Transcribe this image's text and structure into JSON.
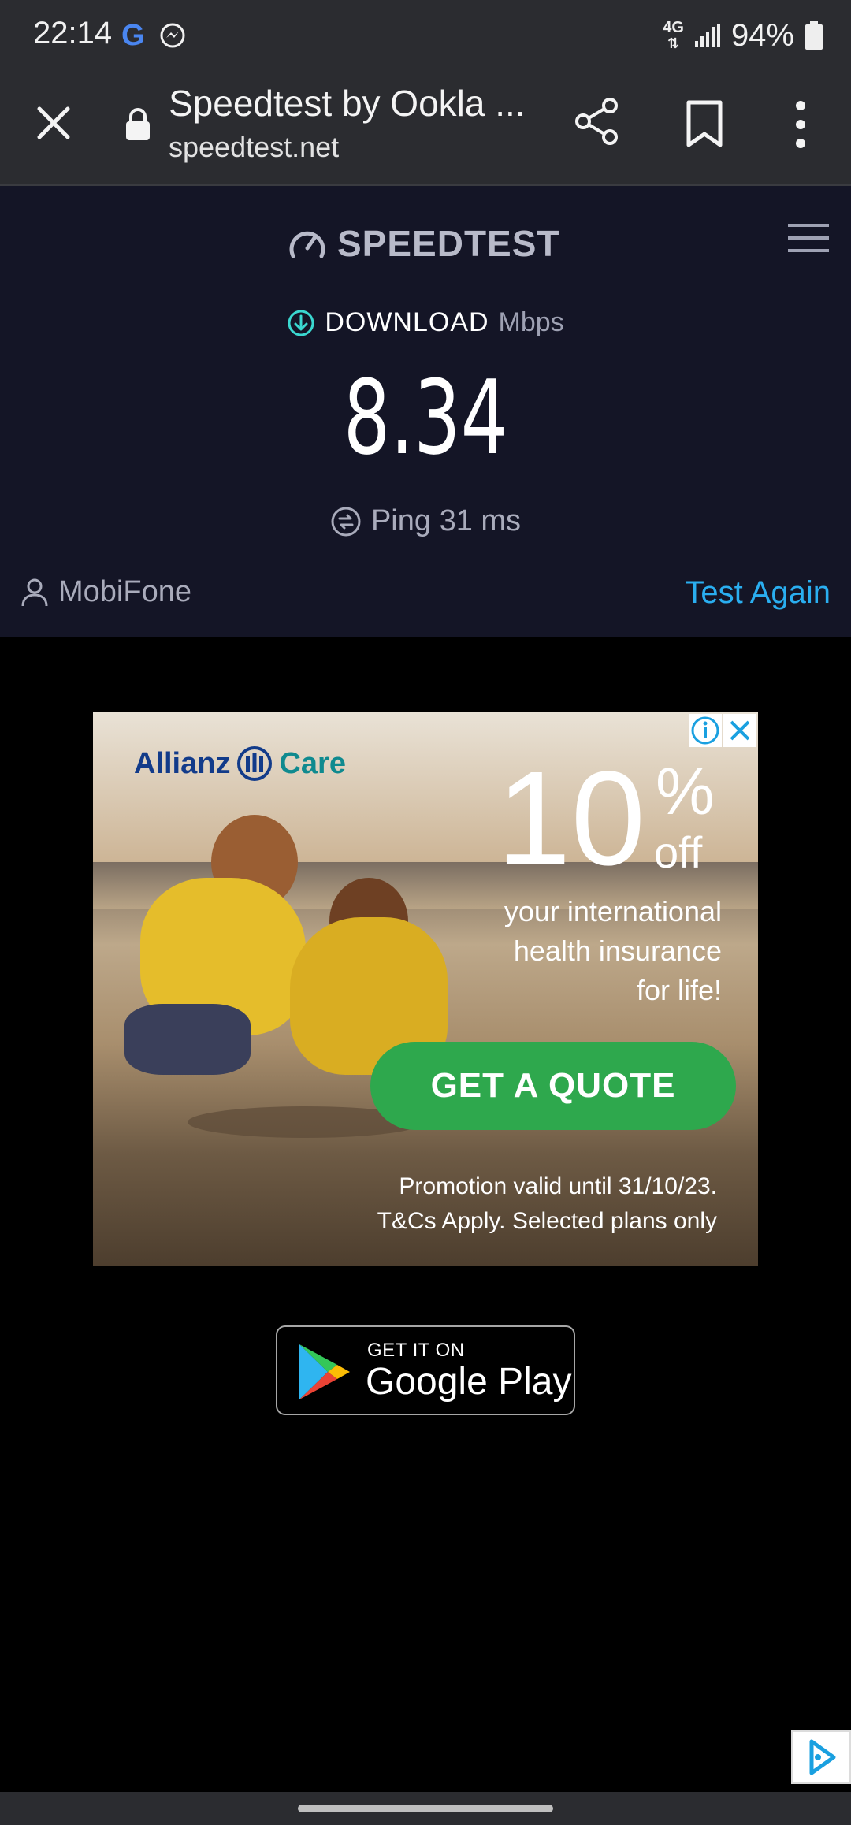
{
  "status_bar": {
    "time": "22:14",
    "network": "4G",
    "battery": "94%"
  },
  "browser": {
    "page_title": "Speedtest by Ookla ...",
    "url": "speedtest.net"
  },
  "speedtest": {
    "logo_text": "SPEEDTEST",
    "download_label": "DOWNLOAD",
    "download_unit": "Mbps",
    "download_value": "8.34",
    "ping_text": "Ping 31 ms",
    "provider": "MobiFone",
    "test_again_label": "Test Again",
    "accent_color": "#2aaef0"
  },
  "ad": {
    "brand_name": "Allianz",
    "brand_product": "Care",
    "discount_number": "10",
    "discount_sign": "%",
    "discount_off": "off",
    "copy_lines": [
      "your international",
      "health insurance",
      "for life!"
    ],
    "cta_label": "GET A QUOTE",
    "fine_print_lines": [
      "Promotion valid until 31/10/23.",
      "T&Cs Apply. Selected plans only"
    ],
    "cta_color": "#2ea84d"
  },
  "store_badge": {
    "small_text": "GET IT ON",
    "big_text": "Google Play"
  }
}
